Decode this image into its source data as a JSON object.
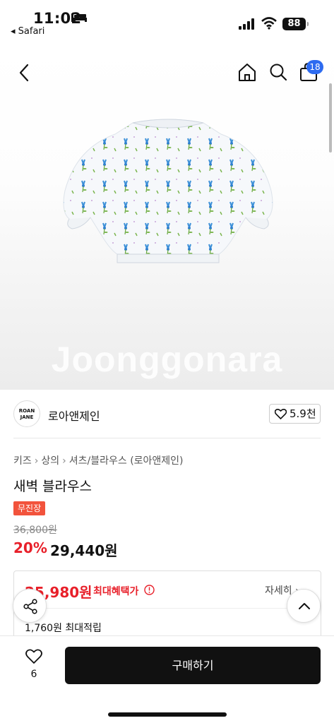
{
  "status_bar": {
    "time": "11:02",
    "back_app": "◂ Safari",
    "battery": "88"
  },
  "header": {
    "cart_count": "18"
  },
  "hero": {
    "watermark": "Joonggonara"
  },
  "seller": {
    "logo_line1": "ROAN",
    "logo_line2": "JANE",
    "name": "로아앤제인",
    "like_count": "5.9천"
  },
  "product": {
    "breadcrumb": [
      "키즈",
      "상의",
      "셔츠/블라우스 (로아앤제인)"
    ],
    "title": "새벽 블라우스",
    "tag": "무진장",
    "original_price": "36,800원",
    "discount": "20%",
    "price": "29,440원"
  },
  "benefit": {
    "max_price": "25,980원",
    "max_label": "최대혜택가",
    "detail_link": "자세히 ›",
    "points": "1,760원 최대적립"
  },
  "bottom_bar": {
    "wish_count": "6",
    "buy_label": "구매하기"
  },
  "colors": {
    "accent_red": "#e8202a",
    "badge_blue": "#2d6bf0",
    "tag_orange": "#f2533c",
    "button_black": "#111111"
  }
}
